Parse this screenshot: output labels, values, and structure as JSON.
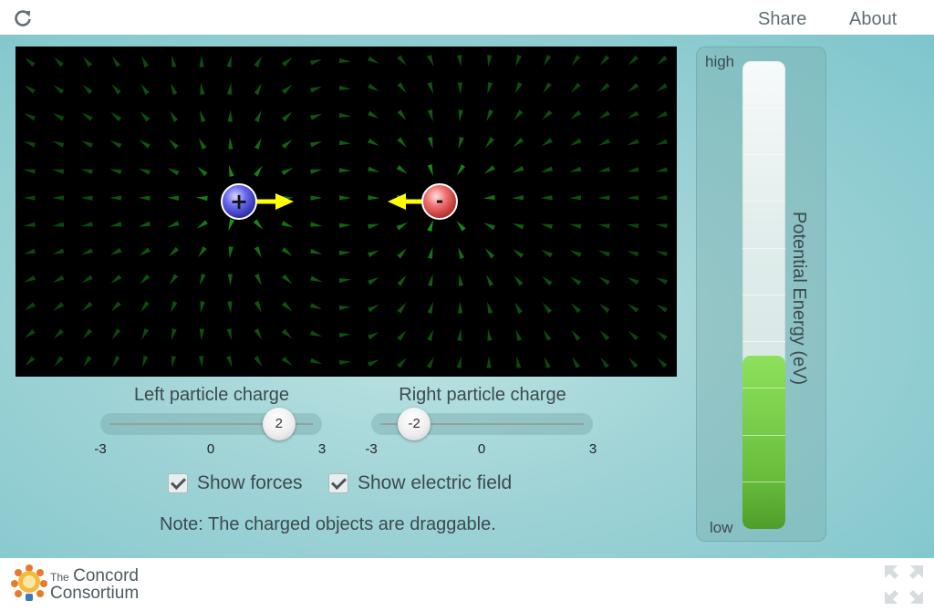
{
  "header": {
    "reload_icon": "reload-icon",
    "share_label": "Share",
    "about_label": "About"
  },
  "simulation": {
    "left_particle": {
      "sign": "+",
      "color": "#4a4ad0"
    },
    "right_particle": {
      "sign": "-",
      "color": "#e04a4a"
    },
    "field_color": "#1eb81e",
    "force_color": "#ffff00"
  },
  "controls": {
    "left_slider": {
      "label": "Left particle charge",
      "value": 2,
      "min": -3,
      "max": 3,
      "ticks": [
        "-3",
        "0",
        "3"
      ]
    },
    "right_slider": {
      "label": "Right particle charge",
      "value": -2,
      "min": -3,
      "max": 3,
      "ticks": [
        "-3",
        "0",
        "3"
      ]
    },
    "show_forces": {
      "label": "Show forces",
      "checked": true
    },
    "show_field": {
      "label": "Show electric field",
      "checked": true
    },
    "note": "Note: The charged objects are draggable."
  },
  "energy_meter": {
    "title": "Potential Energy (eV)",
    "high_label": "high",
    "low_label": "low",
    "fill_fraction": 0.37
  },
  "footer": {
    "logo_the": "The",
    "logo_line1": "Concord",
    "logo_line2": "Consortium",
    "fullscreen_icon": "fullscreen-icon"
  }
}
